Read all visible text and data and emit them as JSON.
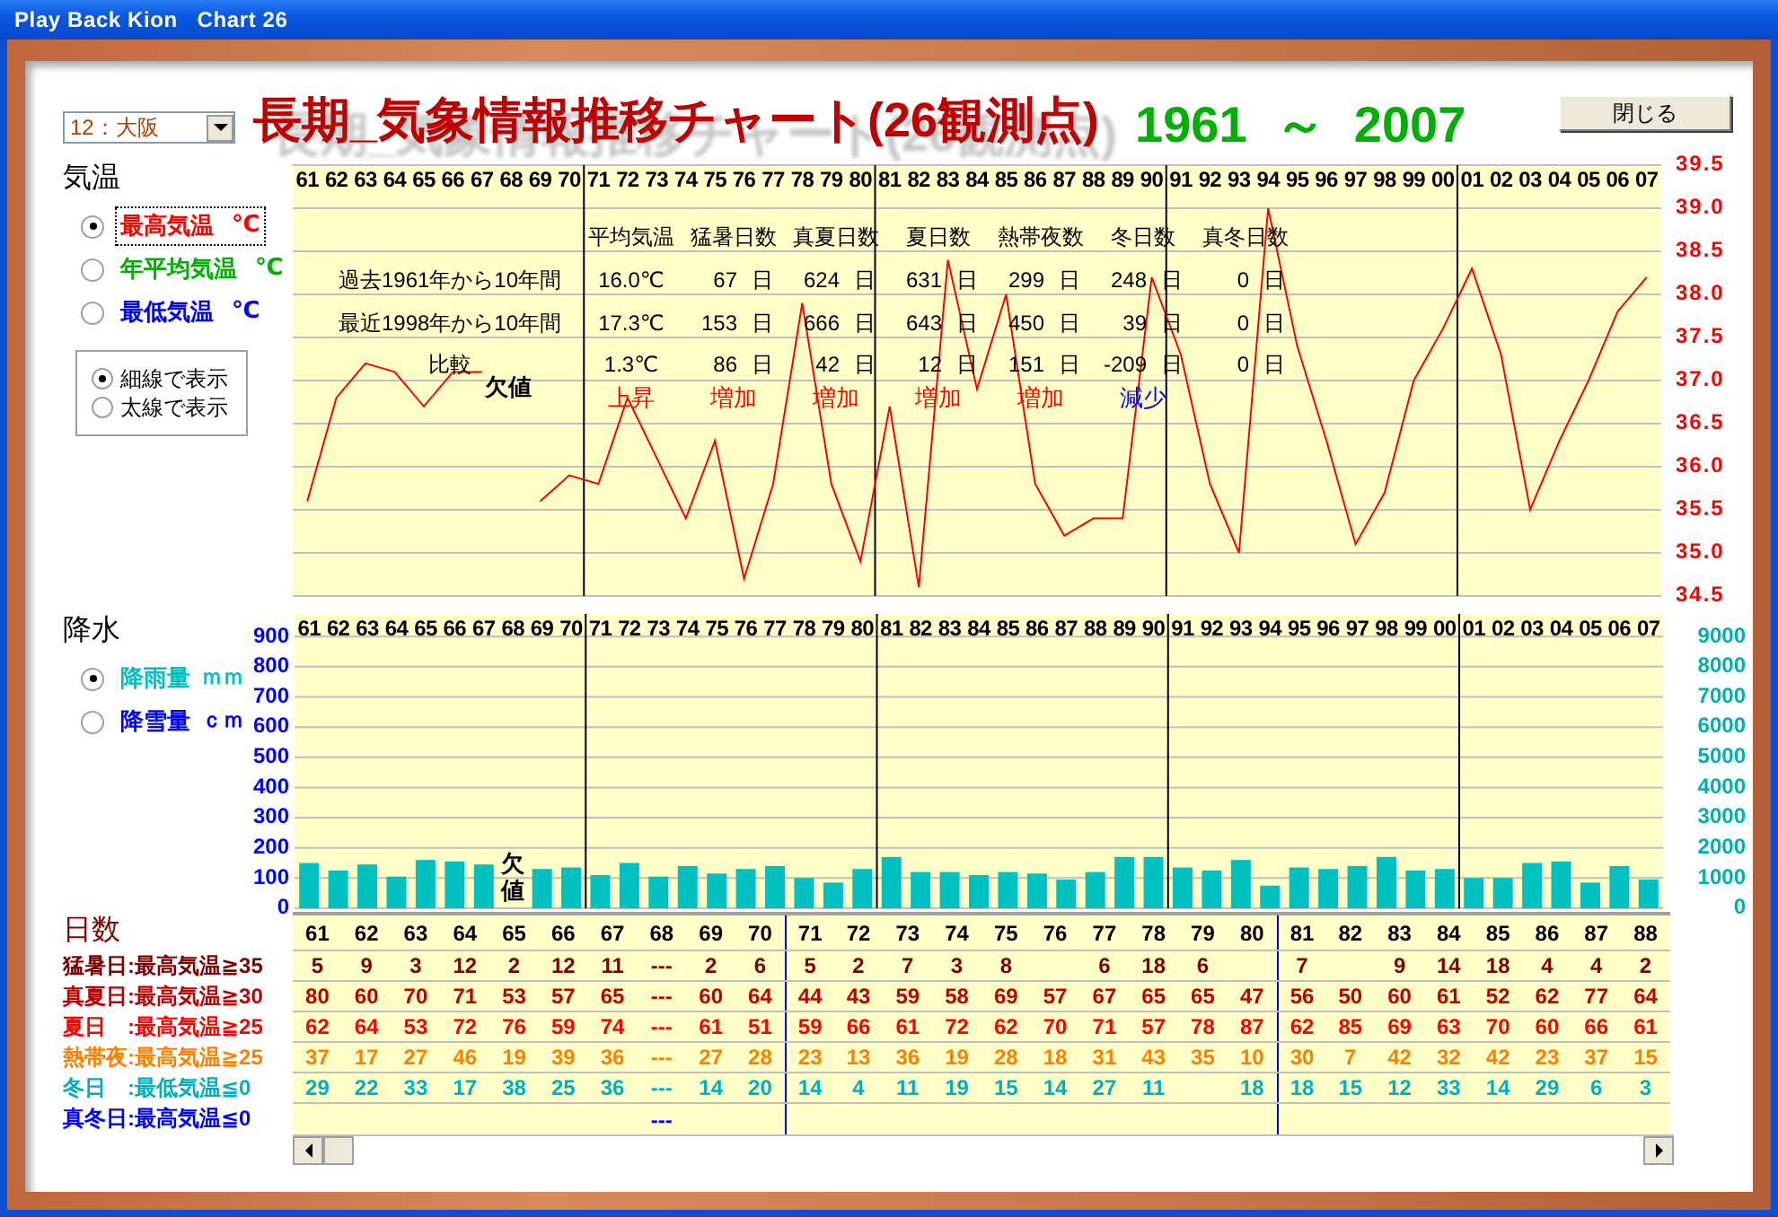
{
  "window": {
    "title": "Play Back Kion   Chart 26"
  },
  "header": {
    "station_select": {
      "value": "12：大阪"
    },
    "title": "長期_気象情報推移チャート(26観測点)",
    "period": "1961 ～ 2007",
    "close_button": "閉じる"
  },
  "temperature": {
    "heading": "気温",
    "measures": [
      {
        "label": "最高気温",
        "unit": "℃",
        "color": "#ff0000",
        "selected": true
      },
      {
        "label": "年平均気温",
        "unit": "℃",
        "color": "#00b000",
        "selected": false
      },
      {
        "label": "最低気温",
        "unit": "℃",
        "color": "#0000ff",
        "selected": false
      }
    ],
    "line_styles": [
      {
        "label": "細線で表示",
        "selected": true
      },
      {
        "label": "太線で表示",
        "selected": false
      }
    ],
    "chart_data": {
      "type": "line",
      "categories": [
        "61",
        "62",
        "63",
        "64",
        "65",
        "66",
        "67",
        "68",
        "69",
        "70",
        "71",
        "72",
        "73",
        "74",
        "75",
        "76",
        "77",
        "78",
        "79",
        "80",
        "81",
        "82",
        "83",
        "84",
        "85",
        "86",
        "87",
        "88",
        "89",
        "90",
        "91",
        "92",
        "93",
        "94",
        "95",
        "96",
        "97",
        "98",
        "99",
        "00",
        "01",
        "02",
        "03",
        "04",
        "05",
        "06",
        "07"
      ],
      "series": [
        {
          "color": "#ff0000",
          "values": [
            35.6,
            36.8,
            37.2,
            37.1,
            36.7,
            37.1,
            37.1,
            null,
            35.6,
            35.9,
            35.8,
            36.8,
            36.1,
            35.4,
            36.3,
            34.7,
            35.8,
            37.9,
            35.8,
            34.9,
            36.7,
            34.6,
            38.4,
            36.9,
            38.0,
            35.8,
            35.2,
            35.4,
            35.4,
            38.2,
            37.3,
            35.8,
            35.0,
            39.0,
            37.4,
            36.3,
            35.1,
            35.7,
            37.0,
            37.6,
            38.3,
            37.3,
            35.5,
            36.3,
            37.0,
            37.8,
            38.2
          ]
        }
      ],
      "ylim": [
        34.5,
        39.5
      ],
      "yticks": [
        {
          "value": 34.5,
          "label": "34.5"
        },
        {
          "value": 35,
          "label": "35.0"
        },
        {
          "value": 35.5,
          "label": "35.5"
        },
        {
          "value": 36,
          "label": "36.0"
        },
        {
          "value": 36.5,
          "label": "36.5"
        },
        {
          "value": 37,
          "label": "37.0"
        },
        {
          "value": 37.5,
          "label": "37.5"
        },
        {
          "value": 38,
          "label": "38.0"
        },
        {
          "value": 38.5,
          "label": "38.5"
        },
        {
          "value": 39,
          "label": "39.0"
        },
        {
          "value": 39.5,
          "label": "39.5"
        }
      ],
      "grid": true,
      "annotations": [
        "欠値"
      ]
    },
    "summary_table": {
      "row_labels": [
        "過去1961年から10年間",
        "最近1998年から10年間",
        "比較"
      ],
      "columns": [
        {
          "header": "平均気温",
          "cells": [
            {
              "value": "16.0℃"
            },
            {
              "value": "17.3℃"
            },
            {
              "value": "1.3℃"
            }
          ],
          "trend": {
            "text": "上昇",
            "color": "#ff0000"
          }
        },
        {
          "header": "猛暑日数",
          "cells": [
            {
              "value": "67",
              "unit": "日"
            },
            {
              "value": "153",
              "unit": "日"
            },
            {
              "value": "86",
              "unit": "日"
            }
          ],
          "trend": {
            "text": "増加",
            "color": "#ff0000"
          }
        },
        {
          "header": "真夏日数",
          "cells": [
            {
              "value": "624",
              "unit": "日"
            },
            {
              "value": "666",
              "unit": "日"
            },
            {
              "value": "42",
              "unit": "日"
            }
          ],
          "trend": {
            "text": "増加",
            "color": "#ff0000"
          }
        },
        {
          "header": "夏日数",
          "cells": [
            {
              "value": "631",
              "unit": "日"
            },
            {
              "value": "643",
              "unit": "日"
            },
            {
              "value": "12",
              "unit": "日"
            }
          ],
          "trend": {
            "text": "増加",
            "color": "#ff0000"
          }
        },
        {
          "header": "熱帯夜数",
          "cells": [
            {
              "value": "299",
              "unit": "日"
            },
            {
              "value": "450",
              "unit": "日"
            },
            {
              "value": "151",
              "unit": "日"
            }
          ],
          "trend": {
            "text": "増加",
            "color": "#ff0000"
          }
        },
        {
          "header": "冬日数",
          "cells": [
            {
              "value": "248",
              "unit": "日"
            },
            {
              "value": "39",
              "unit": "日"
            },
            {
              "value": "-209",
              "unit": "日"
            }
          ],
          "trend": {
            "text": "減少",
            "color": "#0000ff"
          }
        },
        {
          "header": "真冬日数",
          "cells": [
            {
              "value": "0",
              "unit": "日"
            },
            {
              "value": "0",
              "unit": "日"
            },
            {
              "value": "0",
              "unit": "日"
            }
          ]
        }
      ]
    }
  },
  "precipitation": {
    "heading": "降水",
    "measures": [
      {
        "label": "降雨量",
        "unit": "ｍｍ",
        "color": "#00c0c0",
        "selected": true
      },
      {
        "label": "降雪量",
        "unit": "ｃｍ",
        "color": "#0000ff",
        "selected": false
      }
    ],
    "chart_data": {
      "type": "bar",
      "categories": [
        "61",
        "62",
        "63",
        "64",
        "65",
        "66",
        "67",
        "68",
        "69",
        "70",
        "71",
        "72",
        "73",
        "74",
        "75",
        "76",
        "77",
        "78",
        "79",
        "80",
        "81",
        "82",
        "83",
        "84",
        "85",
        "86",
        "87",
        "88",
        "89",
        "90",
        "91",
        "92",
        "93",
        "94",
        "95",
        "96",
        "97",
        "98",
        "99",
        "00",
        "01",
        "02",
        "03",
        "04",
        "05",
        "06",
        "07"
      ],
      "series": [
        {
          "color": "#00c0c0",
          "values": [
            150,
            125,
            145,
            105,
            160,
            155,
            145,
            null,
            130,
            135,
            110,
            150,
            105,
            140,
            115,
            130,
            140,
            100,
            85,
            130,
            170,
            120,
            120,
            110,
            120,
            115,
            95,
            120,
            170,
            170,
            135,
            125,
            160,
            75,
            135,
            130,
            140,
            170,
            125,
            130,
            100,
            100,
            150,
            155,
            85,
            140,
            95
          ]
        }
      ],
      "ylim": [
        0,
        975
      ],
      "yticks": [
        0,
        100,
        200,
        300,
        400,
        500,
        600,
        700,
        800,
        900
      ],
      "grid": true,
      "annotations": [
        "欠値"
      ]
    },
    "right_axis_labels": [
      "9000",
      "8000",
      "7000",
      "6000",
      "5000",
      "4000",
      "3000",
      "2000",
      "1000",
      "0"
    ]
  },
  "days": {
    "heading": "日数",
    "years": [
      "61",
      "62",
      "63",
      "64",
      "65",
      "66",
      "67",
      "68",
      "69",
      "70",
      "71",
      "72",
      "73",
      "74",
      "75",
      "76",
      "77",
      "78",
      "79",
      "80",
      "81",
      "82",
      "83",
      "84",
      "85",
      "86",
      "87",
      "88"
    ],
    "rows": [
      {
        "label": "猛暑日:最高気温≧35",
        "color": "#800000",
        "cells": [
          {
            "kind": "count",
            "value": "5"
          },
          {
            "kind": "count",
            "value": "9"
          },
          {
            "kind": "count",
            "value": "3"
          },
          {
            "kind": "count",
            "value": "12"
          },
          {
            "kind": "count",
            "value": "2"
          },
          {
            "kind": "count",
            "value": "12"
          },
          {
            "kind": "count",
            "value": "11"
          },
          {
            "kind": "count",
            "value": "---"
          },
          {
            "kind": "count",
            "value": "2"
          },
          {
            "kind": "count",
            "value": "6"
          },
          {
            "kind": "count",
            "value": "5"
          },
          {
            "kind": "count",
            "value": "2"
          },
          {
            "kind": "count",
            "value": "7"
          },
          {
            "kind": "count",
            "value": "3"
          },
          {
            "kind": "count",
            "value": "8"
          },
          {
            "kind": "blank"
          },
          {
            "kind": "count",
            "value": "6"
          },
          {
            "kind": "count",
            "value": "18"
          },
          {
            "kind": "count",
            "value": "6"
          },
          {
            "kind": "blank"
          },
          {
            "kind": "count",
            "value": "7"
          },
          {
            "kind": "blank"
          },
          {
            "kind": "count",
            "value": "9"
          },
          {
            "kind": "count",
            "value": "14"
          },
          {
            "kind": "count",
            "value": "18"
          },
          {
            "kind": "count",
            "value": "4"
          },
          {
            "kind": "count",
            "value": "4"
          },
          {
            "kind": "count",
            "value": "2"
          }
        ]
      },
      {
        "label": "真夏日:最高気温≧30",
        "color": "#c00000",
        "cells": [
          {
            "kind": "count",
            "value": "80"
          },
          {
            "kind": "count",
            "value": "60"
          },
          {
            "kind": "count",
            "value": "70"
          },
          {
            "kind": "count",
            "value": "71"
          },
          {
            "kind": "count",
            "value": "53"
          },
          {
            "kind": "count",
            "value": "57"
          },
          {
            "kind": "count",
            "value": "65"
          },
          {
            "kind": "count",
            "value": "---"
          },
          {
            "kind": "count",
            "value": "60"
          },
          {
            "kind": "count",
            "value": "64"
          },
          {
            "kind": "count",
            "value": "44"
          },
          {
            "kind": "count",
            "value": "43"
          },
          {
            "kind": "count",
            "value": "59"
          },
          {
            "kind": "count",
            "value": "58"
          },
          {
            "kind": "count",
            "value": "69"
          },
          {
            "kind": "count",
            "value": "57"
          },
          {
            "kind": "count",
            "value": "67"
          },
          {
            "kind": "count",
            "value": "65"
          },
          {
            "kind": "count",
            "value": "65"
          },
          {
            "kind": "count",
            "value": "47"
          },
          {
            "kind": "count",
            "value": "56"
          },
          {
            "kind": "count",
            "value": "50"
          },
          {
            "kind": "count",
            "value": "60"
          },
          {
            "kind": "count",
            "value": "61"
          },
          {
            "kind": "count",
            "value": "52"
          },
          {
            "kind": "count",
            "value": "62"
          },
          {
            "kind": "count",
            "value": "77"
          },
          {
            "kind": "count",
            "value": "64"
          }
        ]
      },
      {
        "label": "夏日　:最高気温≧25",
        "color": "#ff0000",
        "cells": [
          {
            "kind": "count",
            "value": "62"
          },
          {
            "kind": "count",
            "value": "64"
          },
          {
            "kind": "count",
            "value": "53"
          },
          {
            "kind": "count",
            "value": "72"
          },
          {
            "kind": "count",
            "value": "76"
          },
          {
            "kind": "count",
            "value": "59"
          },
          {
            "kind": "count",
            "value": "74"
          },
          {
            "kind": "count",
            "value": "---"
          },
          {
            "kind": "count",
            "value": "61"
          },
          {
            "kind": "count",
            "value": "51"
          },
          {
            "kind": "count",
            "value": "59"
          },
          {
            "kind": "count",
            "value": "66"
          },
          {
            "kind": "count",
            "value": "61"
          },
          {
            "kind": "count",
            "value": "72"
          },
          {
            "kind": "count",
            "value": "62"
          },
          {
            "kind": "count",
            "value": "70"
          },
          {
            "kind": "count",
            "value": "71"
          },
          {
            "kind": "count",
            "value": "57"
          },
          {
            "kind": "count",
            "value": "78"
          },
          {
            "kind": "count",
            "value": "87"
          },
          {
            "kind": "count",
            "value": "62"
          },
          {
            "kind": "count",
            "value": "85"
          },
          {
            "kind": "count",
            "value": "69"
          },
          {
            "kind": "count",
            "value": "63"
          },
          {
            "kind": "count",
            "value": "70"
          },
          {
            "kind": "count",
            "value": "60"
          },
          {
            "kind": "count",
            "value": "66"
          },
          {
            "kind": "count",
            "value": "61"
          }
        ]
      },
      {
        "label": "熱帯夜:最高気温≧25",
        "color": "#ff8000",
        "cells": [
          {
            "kind": "count",
            "value": "37"
          },
          {
            "kind": "count",
            "value": "17"
          },
          {
            "kind": "count",
            "value": "27"
          },
          {
            "kind": "count",
            "value": "46"
          },
          {
            "kind": "count",
            "value": "19"
          },
          {
            "kind": "count",
            "value": "39"
          },
          {
            "kind": "count",
            "value": "36"
          },
          {
            "kind": "count",
            "value": "---"
          },
          {
            "kind": "count",
            "value": "27"
          },
          {
            "kind": "count",
            "value": "28"
          },
          {
            "kind": "count",
            "value": "23"
          },
          {
            "kind": "count",
            "value": "13"
          },
          {
            "kind": "count",
            "value": "36"
          },
          {
            "kind": "count",
            "value": "19"
          },
          {
            "kind": "count",
            "value": "28"
          },
          {
            "kind": "count",
            "value": "18"
          },
          {
            "kind": "count",
            "value": "31"
          },
          {
            "kind": "count",
            "value": "43"
          },
          {
            "kind": "count",
            "value": "35"
          },
          {
            "kind": "count",
            "value": "10"
          },
          {
            "kind": "count",
            "value": "30"
          },
          {
            "kind": "count",
            "value": "7"
          },
          {
            "kind": "count",
            "value": "42"
          },
          {
            "kind": "count",
            "value": "32"
          },
          {
            "kind": "count",
            "value": "42"
          },
          {
            "kind": "count",
            "value": "23"
          },
          {
            "kind": "count",
            "value": "37"
          },
          {
            "kind": "count",
            "value": "15"
          }
        ]
      },
      {
        "label": "冬日　:最低気温≦0",
        "color": "#00b0c0",
        "cells": [
          {
            "kind": "count",
            "value": "29"
          },
          {
            "kind": "count",
            "value": "22"
          },
          {
            "kind": "count",
            "value": "33"
          },
          {
            "kind": "count",
            "value": "17"
          },
          {
            "kind": "count",
            "value": "38"
          },
          {
            "kind": "count",
            "value": "25"
          },
          {
            "kind": "count",
            "value": "36"
          },
          {
            "kind": "count",
            "value": "---"
          },
          {
            "kind": "count",
            "value": "14"
          },
          {
            "kind": "count",
            "value": "20"
          },
          {
            "kind": "count",
            "value": "14"
          },
          {
            "kind": "count",
            "value": "4"
          },
          {
            "kind": "count",
            "value": "11"
          },
          {
            "kind": "count",
            "value": "19"
          },
          {
            "kind": "count",
            "value": "15"
          },
          {
            "kind": "count",
            "value": "14"
          },
          {
            "kind": "count",
            "value": "27"
          },
          {
            "kind": "count",
            "value": "11"
          },
          {
            "kind": "blank"
          },
          {
            "kind": "count",
            "value": "18"
          },
          {
            "kind": "count",
            "value": "18"
          },
          {
            "kind": "count",
            "value": "15"
          },
          {
            "kind": "count",
            "value": "12"
          },
          {
            "kind": "count",
            "value": "33"
          },
          {
            "kind": "count",
            "value": "14"
          },
          {
            "kind": "count",
            "value": "29"
          },
          {
            "kind": "count",
            "value": "6"
          },
          {
            "kind": "count",
            "value": "3"
          }
        ]
      },
      {
        "label": "真冬日:最高気温≦0",
        "color": "#0000ff",
        "cells": [
          {
            "kind": "blank"
          },
          {
            "kind": "blank"
          },
          {
            "kind": "blank"
          },
          {
            "kind": "blank"
          },
          {
            "kind": "blank"
          },
          {
            "kind": "blank"
          },
          {
            "kind": "blank"
          },
          {
            "kind": "count",
            "value": "---"
          },
          {
            "kind": "blank"
          },
          {
            "kind": "blank"
          },
          {
            "kind": "blank"
          },
          {
            "kind": "blank"
          },
          {
            "kind": "blank"
          },
          {
            "kind": "blank"
          },
          {
            "kind": "blank"
          },
          {
            "kind": "blank"
          },
          {
            "kind": "blank"
          },
          {
            "kind": "blank"
          },
          {
            "kind": "blank"
          },
          {
            "kind": "blank"
          },
          {
            "kind": "blank"
          },
          {
            "kind": "blank"
          },
          {
            "kind": "blank"
          },
          {
            "kind": "blank"
          },
          {
            "kind": "blank"
          },
          {
            "kind": "blank"
          },
          {
            "kind": "blank"
          },
          {
            "kind": "blank"
          }
        ]
      }
    ]
  }
}
